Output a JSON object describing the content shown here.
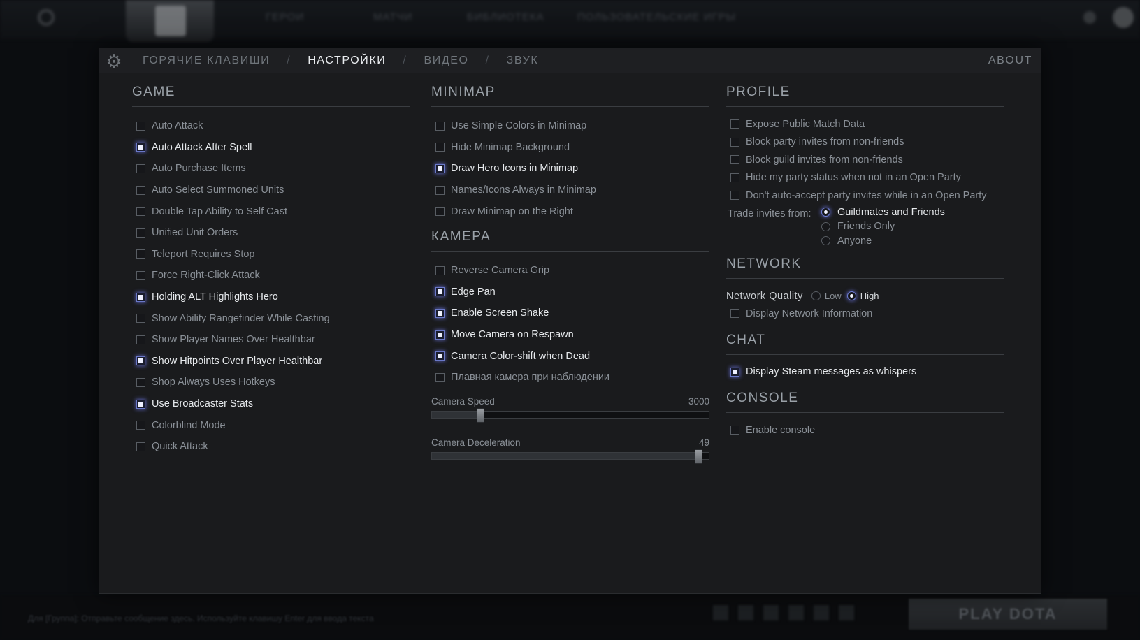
{
  "topbar": {
    "nav": [
      "ГЕРОИ",
      "МАТЧИ",
      "БИБЛИОТЕКА",
      "ПОЛЬЗОВАТЕЛЬСКИЕ ИГРЫ"
    ],
    "play_label": "PLAY DOTA",
    "chat_hint": "Для [Группа]: Отправьте сообщение здесь. Используйте клавишу Enter для ввода текста"
  },
  "header": {
    "tabs": [
      {
        "label": "ГОРЯЧИЕ КЛАВИШИ",
        "active": false
      },
      {
        "label": "НАСТРОЙКИ",
        "active": true
      },
      {
        "label": "ВИДЕО",
        "active": false
      },
      {
        "label": "ЗВУК",
        "active": false
      }
    ],
    "separator": "/",
    "about": "ABOUT"
  },
  "game": {
    "title": "GAME",
    "options": [
      {
        "label": "Auto Attack",
        "checked": false
      },
      {
        "label": "Auto Attack After Spell",
        "checked": true
      },
      {
        "label": "Auto Purchase Items",
        "checked": false
      },
      {
        "label": "Auto Select Summoned Units",
        "checked": false
      },
      {
        "label": "Double Tap Ability to Self Cast",
        "checked": false
      },
      {
        "label": "Unified Unit Orders",
        "checked": false
      },
      {
        "label": "Teleport Requires Stop",
        "checked": false
      },
      {
        "label": "Force Right-Click Attack",
        "checked": false
      },
      {
        "label": "Holding ALT Highlights Hero",
        "checked": true
      },
      {
        "label": "Show Ability Rangefinder While Casting",
        "checked": false
      },
      {
        "label": "Show Player Names Over Healthbar",
        "checked": false
      },
      {
        "label": "Show Hitpoints Over Player Healthbar",
        "checked": true
      },
      {
        "label": "Shop Always Uses Hotkeys",
        "checked": false
      },
      {
        "label": "Use Broadcaster Stats",
        "checked": true
      },
      {
        "label": "Colorblind Mode",
        "checked": false
      },
      {
        "label": "Quick Attack",
        "checked": false
      }
    ]
  },
  "minimap": {
    "title": "MINIMAP",
    "options": [
      {
        "label": "Use Simple Colors in Minimap",
        "checked": false
      },
      {
        "label": "Hide Minimap Background",
        "checked": false
      },
      {
        "label": "Draw Hero Icons in Minimap",
        "checked": true
      },
      {
        "label": "Names/Icons Always in Minimap",
        "checked": false
      },
      {
        "label": "Draw Minimap on the Right",
        "checked": false
      }
    ]
  },
  "camera": {
    "title": "КАМЕРА",
    "options": [
      {
        "label": "Reverse Camera Grip",
        "checked": false
      },
      {
        "label": "Edge Pan",
        "checked": true
      },
      {
        "label": "Enable Screen Shake",
        "checked": true
      },
      {
        "label": "Move Camera on Respawn",
        "checked": true
      },
      {
        "label": "Camera Color-shift when Dead",
        "checked": true
      },
      {
        "label": "Плавная камера при наблюдении",
        "checked": false
      }
    ],
    "speed": {
      "label": "Camera Speed",
      "value": "3000",
      "fraction": 0.175
    },
    "decel": {
      "label": "Camera Deceleration",
      "value": "49",
      "fraction": 0.962
    }
  },
  "profile": {
    "title": "PROFILE",
    "options": [
      {
        "label": "Expose Public Match Data",
        "checked": false
      },
      {
        "label": "Block party invites from non-friends",
        "checked": false
      },
      {
        "label": "Block guild invites from non-friends",
        "checked": false
      },
      {
        "label": "Hide my party status when not in an Open Party",
        "checked": false
      },
      {
        "label": "Don't auto-accept party invites while in an Open Party",
        "checked": false
      }
    ],
    "trade_label": "Trade invites from:",
    "trade_options": [
      {
        "label": "Guildmates and Friends",
        "selected": true
      },
      {
        "label": "Friends Only",
        "selected": false
      },
      {
        "label": "Anyone",
        "selected": false
      }
    ]
  },
  "network": {
    "title": "NETWORK",
    "quality_label": "Network Quality",
    "low": "Low",
    "high": "High",
    "selected": "High",
    "display_info": {
      "label": "Display Network Information",
      "checked": false
    }
  },
  "chat": {
    "title": "CHAT",
    "whispers": {
      "label": "Display Steam messages as whispers",
      "checked": true
    }
  },
  "console": {
    "title": "CONSOLE",
    "enable": {
      "label": "Enable console",
      "checked": false
    }
  }
}
